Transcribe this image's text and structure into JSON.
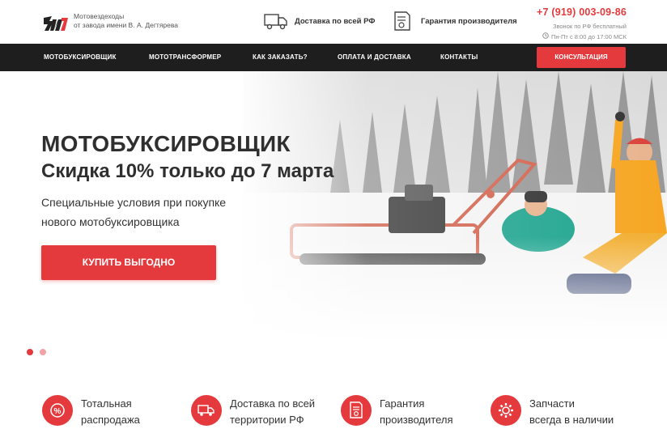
{
  "header": {
    "tagline_line1": "Мотовездеходы",
    "tagline_line2": "от завода имени В. А. Дегтярева",
    "delivery": "Доставка по всей РФ",
    "warranty": "Гарантия производителя",
    "phone": "+7 (919) 003-09-86",
    "call_note": "Звонок по РФ бесплатный",
    "hours": "Пн-Пт с 8:00 до 17:00 МСК"
  },
  "nav": {
    "items": [
      "МОТОБУКСИРОВЩИК",
      "МОТОТРАНСФОРМЕР",
      "КАК ЗАКАЗАТЬ?",
      "ОПЛАТА И ДОСТАВКА",
      "КОНТАКТЫ"
    ],
    "consult": "КОНСУЛЬТАЦИЯ"
  },
  "hero": {
    "title": "МОТОБУКСИРОВЩИК",
    "subtitle": "Скидка 10% только до 7 марта",
    "text_line1": "Специальные условия при покупке",
    "text_line2": "нового мотобуксировщика",
    "button": "КУПИТЬ ВЫГОДНО",
    "slides_total": 2,
    "slide_active": 1
  },
  "features": [
    {
      "line1": "Тотальная",
      "line2": "распродажа",
      "icon": "sale-icon"
    },
    {
      "line1": "Доставка по всей",
      "line2": "территории РФ",
      "icon": "truck-icon"
    },
    {
      "line1": "Гарантия",
      "line2": "производителя",
      "icon": "certificate-icon"
    },
    {
      "line1": "Запчасти",
      "line2": "всегда в наличии",
      "icon": "gear-icon"
    }
  ],
  "colors": {
    "accent": "#e53a3d",
    "nav_bg": "#1e1e1e",
    "text": "#2f2f2f"
  }
}
